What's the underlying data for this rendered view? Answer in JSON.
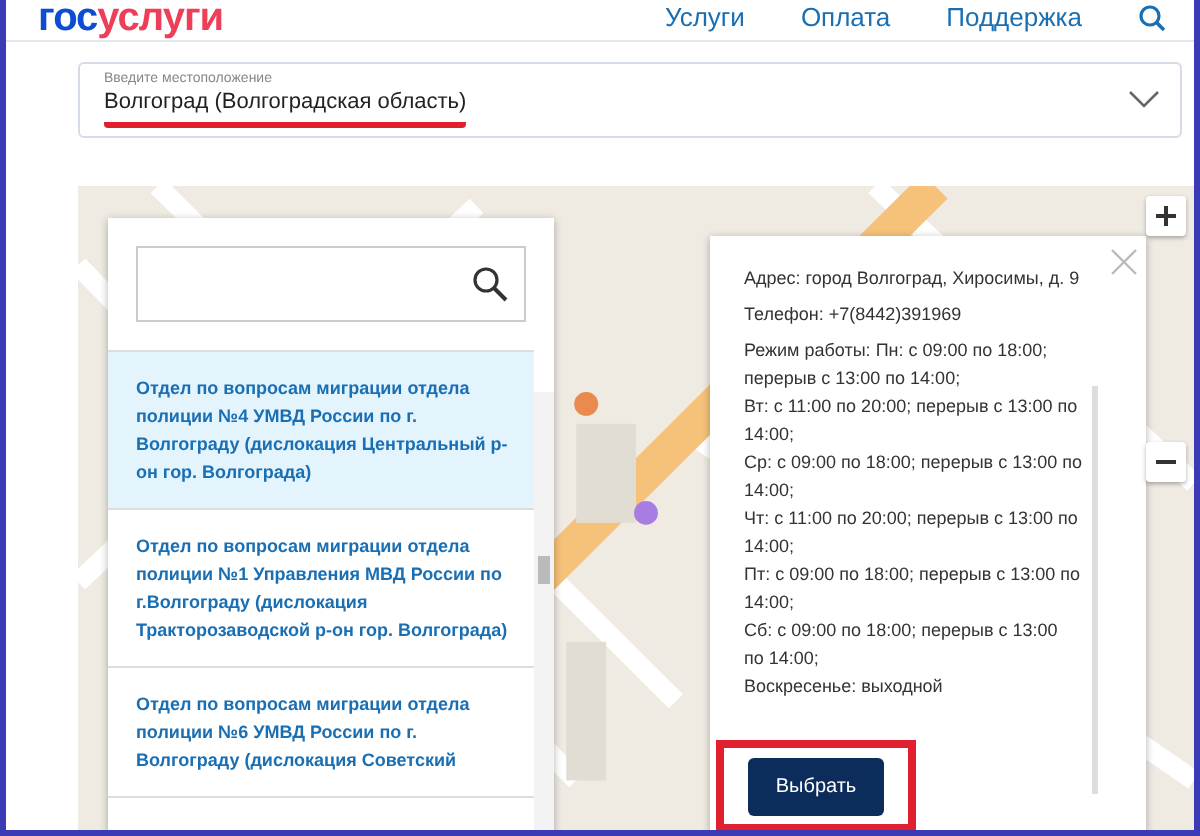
{
  "header": {
    "logo_prefix": "гос",
    "logo_suffix": "услуги",
    "nav": [
      "Услуги",
      "Оплата",
      "Поддержка"
    ]
  },
  "location": {
    "label": "Введите местоположение",
    "value": "Волгоград (Волгоградская область)"
  },
  "office_list": {
    "items": [
      {
        "text": "Отдел по вопросам миграции отдела полиции №4 УМВД России по г. Волгограду (дислокация Центральный р-он гор. Волгограда)",
        "selected": true
      },
      {
        "text": "Отдел по вопросам миграции отдела полиции №1 Управления МВД России по г.Волгограду (дислокация Тракторозаводской р-он гор. Волгограда)",
        "selected": false
      },
      {
        "text": "Отдел по вопросам миграции отдела полиции №6 УМВД России по г. Волгограду (дислокация Советский",
        "selected": false
      }
    ]
  },
  "popup": {
    "address": "Адрес: город Волгоград, Хиросимы, д. 9",
    "phone": "Телефон: +7(8442)391969",
    "schedule": [
      "Режим работы: Пн: с 09:00 по 18:00; перерыв с 13:00 по 14:00;",
      "Вт: с 11:00 по 20:00; перерыв с 13:00 по 14:00;",
      "Ср: с 09:00 по 18:00; перерыв с 13:00 по 14:00;",
      "Чт: с 11:00 по 20:00; перерыв с 13:00 по 14:00;",
      "Пт: с 09:00 по 18:00; перерыв с 13:00 по 14:00;",
      "Сб: с 09:00 по 18:00; перерыв с 13:00 по 14:00;",
      "Воскресенье: выходной"
    ],
    "button": "Выбрать"
  }
}
